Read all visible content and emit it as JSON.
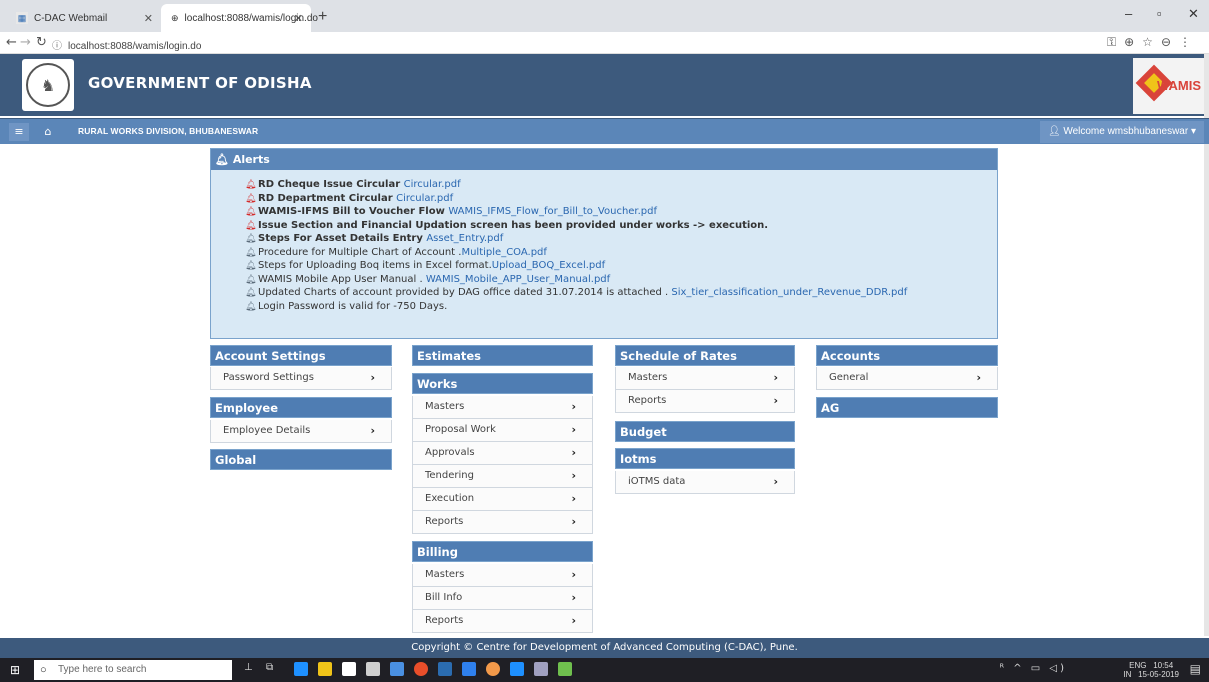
{
  "browser": {
    "tabs": [
      {
        "title": "C-DAC Webmail",
        "active": false
      },
      {
        "title": "localhost:8088/wamis/login.do",
        "active": true
      }
    ],
    "url": "localhost:8088/wamis/login.do"
  },
  "header": {
    "title": "GOVERNMENT OF ODISHA",
    "logo_text": "WAMIS"
  },
  "navbar": {
    "division": "RURAL WORKS DIVISION, BHUBANESWAR",
    "welcome": "Welcome wmsbhubaneswar"
  },
  "alerts": {
    "title": "Alerts",
    "items": [
      {
        "text": "RD Cheque Issue Circular ",
        "link": "Circular.pdf",
        "level": "red",
        "bold": true
      },
      {
        "text": "RD Department Circular ",
        "link": "Circular.pdf",
        "level": "red",
        "bold": true
      },
      {
        "text": "WAMIS-IFMS Bill to Voucher Flow ",
        "link": "WAMIS_IFMS_Flow_for_Bill_to_Voucher.pdf",
        "level": "red",
        "bold": true
      },
      {
        "text": "Issue Section and Financial Updation screen has been provided under works -> execution.",
        "link": "",
        "level": "red",
        "bold": true
      },
      {
        "text": "Steps For Asset Details Entry ",
        "link": "Asset_Entry.pdf",
        "level": "grey",
        "bold": true
      },
      {
        "text": "Procedure for Multiple Chart of Account .",
        "link": "Multiple_COA.pdf",
        "level": "grey",
        "bold": false
      },
      {
        "text": "Steps for Uploading Boq items in Excel format.",
        "link": "Upload_BOQ_Excel.pdf",
        "level": "grey",
        "bold": false
      },
      {
        "text": "WAMIS Mobile App User Manual . ",
        "link": "WAMIS_Mobile_APP_User_Manual.pdf",
        "level": "grey",
        "bold": false
      },
      {
        "text": "Updated Charts of account provided by DAG office dated 31.07.2014 is attached . ",
        "link": "Six_tier_classification_under_Revenue_DDR.pdf",
        "level": "grey",
        "bold": false
      },
      {
        "text": "Login Password is valid for -750 Days.",
        "link": "",
        "level": "grey",
        "bold": false
      }
    ]
  },
  "menus": {
    "account_settings": {
      "title": "Account Settings",
      "items": [
        "Password Settings"
      ]
    },
    "employee": {
      "title": "Employee",
      "items": [
        "Employee Details"
      ]
    },
    "global": {
      "title": "Global"
    },
    "estimates": {
      "title": "Estimates"
    },
    "works": {
      "title": "Works",
      "items": [
        "Masters",
        "Proposal Work",
        "Approvals",
        "Tendering",
        "Execution",
        "Reports"
      ]
    },
    "billing": {
      "title": "Billing",
      "items": [
        "Masters",
        "Bill Info",
        "Reports"
      ]
    },
    "schedule_of_rates": {
      "title": "Schedule of Rates",
      "items": [
        "Masters",
        "Reports"
      ]
    },
    "budget": {
      "title": "Budget"
    },
    "iotms": {
      "title": "Iotms",
      "items": [
        "iOTMS data"
      ]
    },
    "accounts": {
      "title": "Accounts",
      "items": [
        "General"
      ]
    },
    "ag": {
      "title": "AG"
    }
  },
  "footer": {
    "copyright": "Copyright © Centre for Development of Advanced Computing (C-DAC), Pune."
  },
  "taskbar": {
    "search_placeholder": "Type here to search",
    "lang": "ENG",
    "region": "IN",
    "time": "10:54",
    "date": "15-05-2019"
  }
}
